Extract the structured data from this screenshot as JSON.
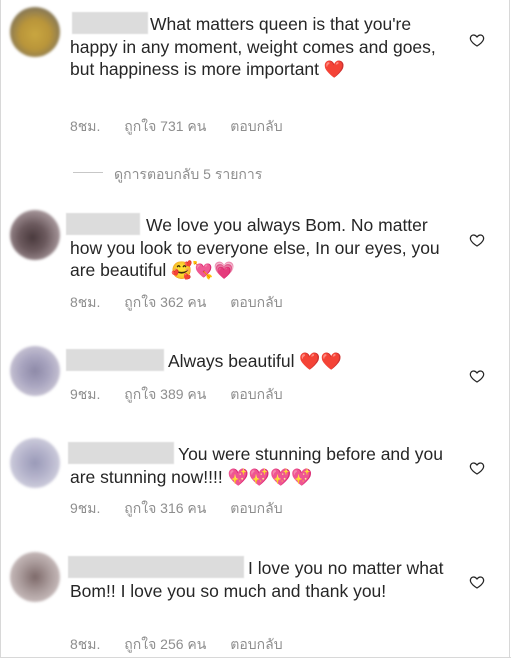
{
  "comments": [
    {
      "text": "What matters queen is that you're happy in any moment, weight comes and goes, but happiness is more important",
      "emoji": "❤️",
      "time": "8ชม.",
      "likes": "ถูกใจ 731 คน",
      "reply": "ตอบกลับ"
    },
    {
      "text": "We love you always Bom. No matter how you look to everyone else, In our eyes, you are beautiful",
      "emoji": "🥰💘💗",
      "time": "8ชม.",
      "likes": "ถูกใจ 362 คน",
      "reply": "ตอบกลับ"
    },
    {
      "text": "Always beautiful",
      "emoji": "❤️❤️",
      "time": "9ชม.",
      "likes": "ถูกใจ 389 คน",
      "reply": "ตอบกลับ"
    },
    {
      "text": "You were stunning before and you are stunning now!!!!",
      "emoji": "💖💖💖💖",
      "time": "9ชม.",
      "likes": "ถูกใจ 316 คน",
      "reply": "ตอบกลับ"
    },
    {
      "text": "I love you no matter what Bom!! I love you so much and thank you!",
      "emoji": "",
      "time": "8ชม.",
      "likes": "ถูกใจ 256 คน",
      "reply": "ตอบกลับ"
    }
  ],
  "view_replies": "ดูการตอบกลับ 5 รายการ",
  "icons": {
    "like": "heart-outline-icon"
  }
}
